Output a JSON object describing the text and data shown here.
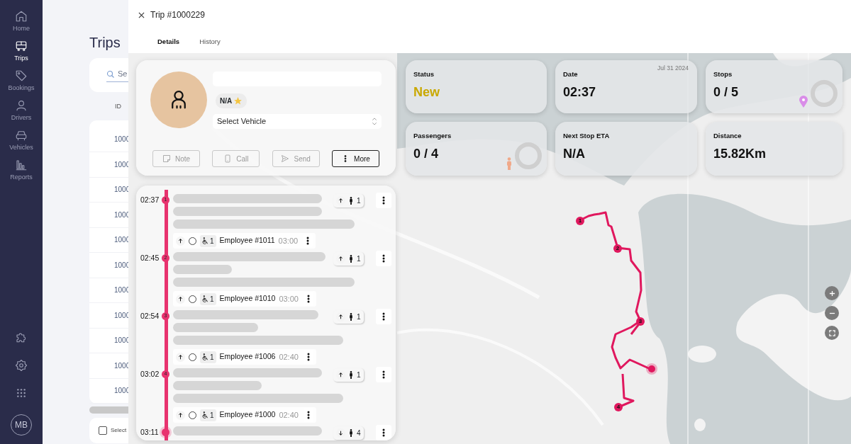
{
  "sidebar": {
    "items": [
      {
        "label": "Home",
        "selected": false
      },
      {
        "label": "Trips",
        "selected": true
      },
      {
        "label": "Bookings",
        "selected": false
      },
      {
        "label": "Drivers",
        "selected": false
      },
      {
        "label": "Vehicles",
        "selected": false
      },
      {
        "label": "Reports",
        "selected": false
      }
    ],
    "avatar": "MB"
  },
  "trips_page": {
    "title": "Trips",
    "search": {
      "placeholder": "Se"
    },
    "columns": [
      "ID"
    ],
    "rows": [
      "1000",
      "1000",
      "1000",
      "1000",
      "1000",
      "1000",
      "1000",
      "1000",
      "1000",
      "1000",
      "1000"
    ],
    "footer": {
      "label": "Select",
      "checked": false
    }
  },
  "trip_panel": {
    "title": "Trip #1000229",
    "tabs": [
      {
        "label": "Details",
        "selected": true
      },
      {
        "label": "History",
        "selected": false
      }
    ],
    "driver": {
      "rating": "N/A",
      "vehicle_select": {
        "placeholder": "Select Vehicle"
      },
      "actions": [
        {
          "label": "Note",
          "kind": "note",
          "disabled": true
        },
        {
          "label": "Call",
          "kind": "call",
          "disabled": true
        },
        {
          "label": "Send",
          "kind": "send",
          "disabled": true
        },
        {
          "label": "More",
          "kind": "more",
          "disabled": false
        }
      ]
    },
    "stats": [
      {
        "label": "Status",
        "value": "New",
        "kind": "status"
      },
      {
        "label": "Date",
        "value": "02:37",
        "note": "Jul 31 2024",
        "kind": "plain"
      },
      {
        "label": "Stops",
        "value": "0 / 5",
        "kind": "stops"
      },
      {
        "label": "Passengers",
        "value": "0 / 4",
        "kind": "passengers"
      },
      {
        "label": "Next Stop ETA",
        "value": "N/A",
        "kind": "plain"
      },
      {
        "label": "Distance",
        "value": "15.82Km",
        "kind": "plain"
      }
    ],
    "stops": [
      {
        "time": "02:37",
        "number": "1",
        "dropoff": false,
        "count": "1",
        "passenger": {
          "checked": false,
          "count": "1",
          "name": "Employee #1011",
          "time": "03:00"
        }
      },
      {
        "time": "02:45",
        "number": "2",
        "dropoff": false,
        "count": "1",
        "passenger": {
          "checked": false,
          "count": "1",
          "name": "Employee #1010",
          "time": "03:00"
        }
      },
      {
        "time": "02:54",
        "number": "3",
        "dropoff": false,
        "count": "1",
        "passenger": {
          "checked": false,
          "count": "1",
          "name": "Employee #1006",
          "time": "02:40"
        }
      },
      {
        "time": "03:02",
        "number": "4",
        "dropoff": false,
        "count": "1",
        "passenger": {
          "checked": false,
          "count": "1",
          "name": "Employee #1000",
          "time": "02:40"
        }
      },
      {
        "time": "03:11",
        "dropoff": true,
        "count": "4"
      }
    ],
    "map": {
      "markers": [
        "1",
        "2",
        "3",
        "4"
      ]
    }
  }
}
